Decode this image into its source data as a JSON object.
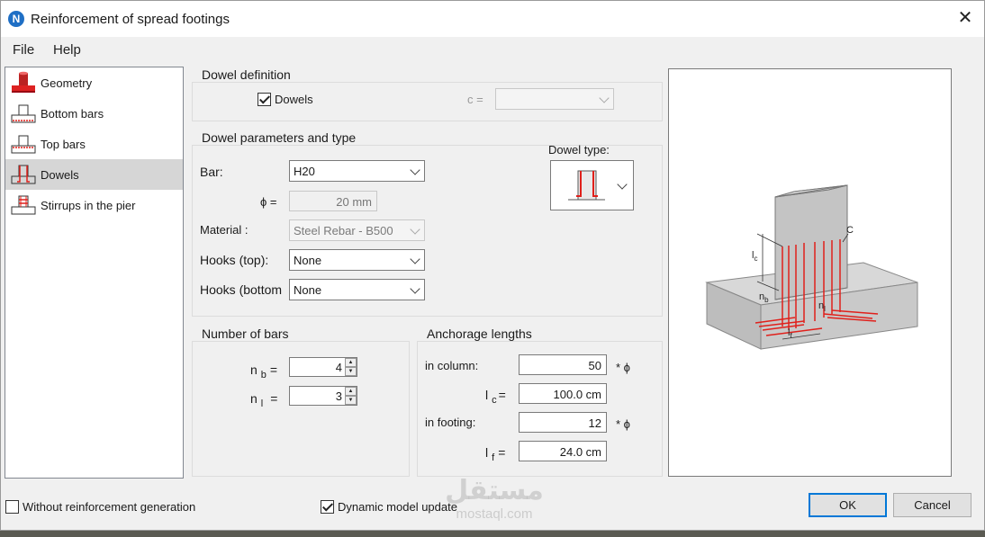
{
  "window": {
    "title": "Reinforcement of spread footings",
    "app_icon": "N"
  },
  "menu": [
    "File",
    "Help"
  ],
  "nav": [
    {
      "label": "Geometry",
      "icon": "footing-geometry-icon"
    },
    {
      "label": "Bottom bars",
      "icon": "bottom-bars-icon"
    },
    {
      "label": "Top bars",
      "icon": "top-bars-icon"
    },
    {
      "label": "Dowels",
      "icon": "dowels-icon",
      "selected": true
    },
    {
      "label": "Stirrups in the pier",
      "icon": "stirrups-icon"
    }
  ],
  "dowel_definition": {
    "title": "Dowel definition",
    "dowels_label": "Dowels",
    "dowels_checked": true,
    "c_label": "c =",
    "c_value": ""
  },
  "dowel_params": {
    "title": "Dowel parameters and type",
    "bar_label": "Bar:",
    "bar_value": "H20",
    "phi_label": "ϕ =",
    "phi_value": "20 mm",
    "material_label": "Material :",
    "material_value": "Steel Rebar - B500",
    "hooks_top_label": "Hooks (top):",
    "hooks_top_value": "None",
    "hooks_bottom_label": "Hooks (bottom",
    "hooks_bottom_value": "None",
    "dowel_type_label": "Dowel type:"
  },
  "number_of_bars": {
    "title": "Number of bars",
    "nb_label": "n",
    "nb_sub": "b",
    "nb_value": "4",
    "nl_label": "n",
    "nl_sub": "l",
    "nl_value": "3",
    "eq": "="
  },
  "anchorage": {
    "title": "Anchorage lengths",
    "in_column_label": "in column:",
    "in_column_value": "50",
    "lc_label": "l",
    "lc_sub": "c",
    "lc_value": "100.0 cm",
    "in_footing_label": "in footing:",
    "in_footing_value": "12",
    "lf_label": "l",
    "lf_sub": "f",
    "lf_value": "24.0 cm",
    "times_phi": "* ϕ",
    "eq": "="
  },
  "preview_labels": {
    "lc": "l",
    "lc_sub": "c",
    "c": "C",
    "nb": "n",
    "nb_sub": "b",
    "nl": "n",
    "nl_sub": "l",
    "lf": "l",
    "lf_sub": "f"
  },
  "footer": {
    "without_reinf_label": "Without reinforcement generation",
    "without_reinf_checked": false,
    "dynamic_update_label": "Dynamic model update",
    "dynamic_update_checked": true,
    "ok_label": "OK",
    "cancel_label": "Cancel"
  },
  "watermark": {
    "arabic": "مستقل",
    "latin": "mostaql.com"
  },
  "colors": {
    "accent": "#0078d7",
    "rebar": "#e0201b",
    "concrete": "#c8c8c8",
    "selected_nav": "#d6d6d6"
  }
}
